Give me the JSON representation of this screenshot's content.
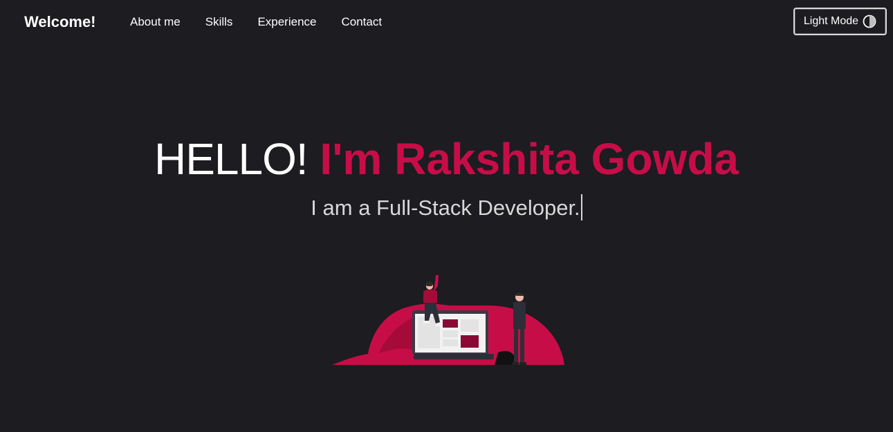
{
  "nav": {
    "brand": "Welcome!",
    "links": [
      "About me",
      "Skills",
      "Experience",
      "Contact"
    ],
    "mode_toggle_label": "Light Mode",
    "mode_toggle_icon": "half-circle-contrast-icon"
  },
  "hero": {
    "greeting": "HELLO!",
    "name": "I'm Rakshita Gowda",
    "subtitle": "I am a Full-Stack Developer."
  },
  "colors": {
    "background": "#1c1c21",
    "accent": "#c70d47",
    "text": "#ffffff"
  }
}
